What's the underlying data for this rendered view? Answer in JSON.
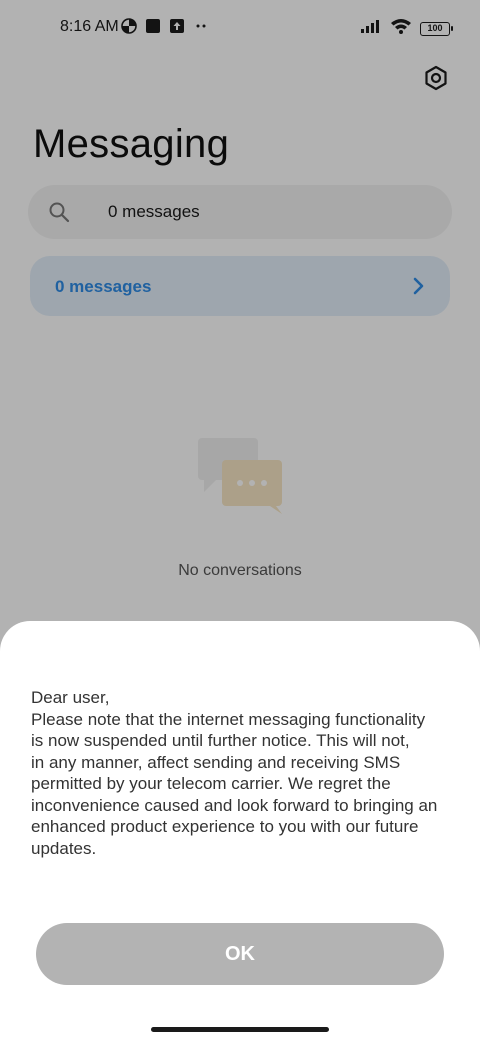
{
  "status_bar": {
    "time": "8:16 AM",
    "left_icons": [
      "data-saver-icon",
      "stop-square-icon",
      "upload-icon",
      "more-dots-icon"
    ],
    "right_icons": [
      "signal-icon",
      "wifi-icon",
      "battery-icon"
    ],
    "battery_level": "100"
  },
  "header": {
    "title": "Messaging",
    "settings_icon": "settings-gear-icon"
  },
  "search": {
    "value": "0 messages"
  },
  "summary_card": {
    "label": "0 messages"
  },
  "empty_state": {
    "text": "No conversations"
  },
  "dialog": {
    "message_lines": [
      "Dear user,",
      "Please note that the internet messaging functionality",
      "is now suspended until further notice. This will not,",
      "in any manner, affect sending and receiving SMS",
      "permitted by your telecom carrier. We regret the",
      "inconvenience caused and look forward to bringing an",
      "enhanced product experience to you with our future",
      "updates."
    ],
    "ok_label": "OK"
  },
  "colors": {
    "accent_blue": "#2f8ce6",
    "card_bg": "#e2eefa",
    "scrim": "rgba(0,0,0,0.3)"
  }
}
